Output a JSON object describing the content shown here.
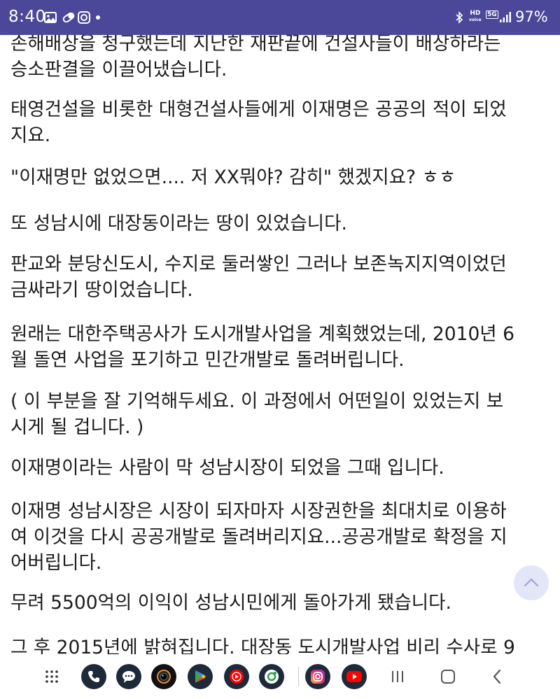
{
  "status_bar": {
    "time": "8:40",
    "hd_label": "HD\nvoice",
    "network_label": "5G",
    "battery": "97%",
    "icons": [
      "gallery-icon",
      "pill-icon",
      "camera-app-icon",
      "notification-dot",
      "bluetooth-icon",
      "hd-voice-icon",
      "5g-icon",
      "signal-icon",
      "battery-text"
    ]
  },
  "article": {
    "paragraphs": [
      [
        "손해배상을 청구했는데 지난한 재판끝에 건설사들이 배상하라는",
        "승소판결을 이끌어냈습니다."
      ],
      [
        "태영건설을 비롯한 대형건설사들에게 이재명은 공공의 적이 되었",
        "지요."
      ],
      [
        "\"이재명만 없었으면.... 저 XX뭐야? 감히\" 했겠지요? ㅎㅎ"
      ],
      [
        "또 성남시에 대장동이라는 땅이 있었습니다."
      ],
      [
        "판교와 분당신도시, 수지로 둘러쌓인 그러나 보존녹지지역이었던",
        "금싸라기 땅이었습니다."
      ],
      [
        "원래는 대한주택공사가 도시개발사업을 계획했었는데, 2010년 6",
        "월 돌연 사업을 포기하고 민간개발로 돌려버립니다."
      ],
      [
        "( 이 부분을 잘 기억해두세요. 이 과정에서 어떤일이 있었는지 보",
        "시게 될 겁니다. )"
      ],
      [
        "이재명이라는 사람이 막 성남시장이 되었을 그때 입니다."
      ],
      [
        "이재명 성남시장은 시장이 되자마자 시장권한을 최대치로 이용하",
        "여 이것을 다시 공공개발로 돌려버리지요...공공개발로 확정을 지",
        "어버립니다."
      ],
      [
        "무려 5500억의 이익이 성남시민에게 돌아가게 됐습니다."
      ],
      [
        "그 후 2015년에 밝혀집니다. 대장동 도시개발사업 비리 수사로 9"
      ]
    ]
  },
  "scroll_top": {
    "icon": "chevron-up-icon"
  },
  "nav_bar": {
    "apps": [
      "app-drawer-icon",
      "phone-icon",
      "messages-icon",
      "camera-icon",
      "play-store-icon",
      "youtube-music-icon",
      "recorder-icon",
      "instagram-icon",
      "youtube-icon"
    ],
    "buttons": [
      "recents-button",
      "home-button",
      "back-button"
    ]
  },
  "colors": {
    "status_bar": "#4b489a",
    "text": "#1c1c1c",
    "scroll_top_bg": "#e2e6f6"
  }
}
